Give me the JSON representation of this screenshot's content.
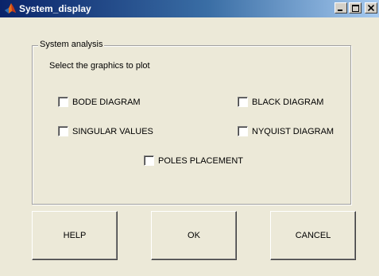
{
  "window": {
    "title": "System_display",
    "icon": "matlab-logo-icon",
    "controls": {
      "minimize": "_",
      "maximize": "□",
      "close": "×"
    }
  },
  "group": {
    "title": "System analysis",
    "instruction": "Select the graphics to plot",
    "options": [
      {
        "label": "BODE DIAGRAM",
        "checked": false
      },
      {
        "label": "BLACK DIAGRAM",
        "checked": false
      },
      {
        "label": "SINGULAR VALUES",
        "checked": false
      },
      {
        "label": "NYQUIST  DIAGRAM",
        "checked": false
      },
      {
        "label": "POLES PLACEMENT",
        "checked": false
      }
    ]
  },
  "buttons": {
    "help": "HELP",
    "ok": "OK",
    "cancel": "CANCEL"
  },
  "colors": {
    "titlebar_start": "#0a246a",
    "titlebar_end": "#a6caf0",
    "face": "#ece9d8"
  }
}
